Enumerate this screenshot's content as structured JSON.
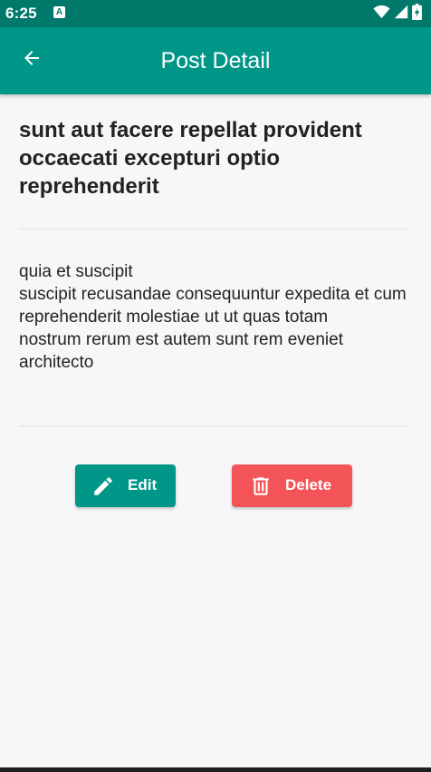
{
  "status_bar": {
    "time": "6:25",
    "notification_icon": "a-notification-icon",
    "icons": [
      "wifi-icon",
      "signal-icon",
      "battery-charging-icon"
    ],
    "background_color": "#00796b"
  },
  "app_bar": {
    "title": "Post Detail",
    "back_icon": "arrow-back-icon",
    "background_color": "#009688"
  },
  "post": {
    "title": "sunt aut facere repellat provident occaecati excepturi optio reprehenderit",
    "body": "quia et suscipit\nsuscipit recusandae consequuntur expedita et cum\nreprehenderit molestiae ut ut quas totam\nnostrum rerum est autem sunt rem eveniet architecto"
  },
  "actions": {
    "edit_label": "Edit",
    "edit_icon": "pencil-icon",
    "edit_color": "#009688",
    "delete_label": "Delete",
    "delete_icon": "trash-icon",
    "delete_color": "#f25457"
  }
}
